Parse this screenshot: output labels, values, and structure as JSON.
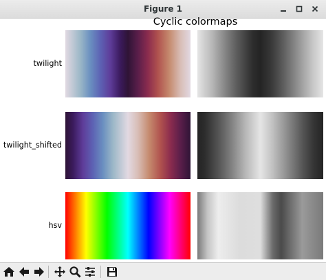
{
  "window": {
    "title": "Figure 1",
    "controls": [
      "minimize-icon",
      "maximize-icon",
      "close-icon"
    ]
  },
  "figure": {
    "title": "Cyclic colormaps",
    "rows": [
      {
        "label": "twilight"
      },
      {
        "label": "twilight_shifted"
      },
      {
        "label": "hsv"
      }
    ]
  },
  "toolbar": {
    "buttons": [
      "home-icon",
      "back-icon",
      "forward-icon",
      "pan-icon",
      "zoom-icon",
      "configure-subplots-icon",
      "save-icon"
    ]
  }
}
